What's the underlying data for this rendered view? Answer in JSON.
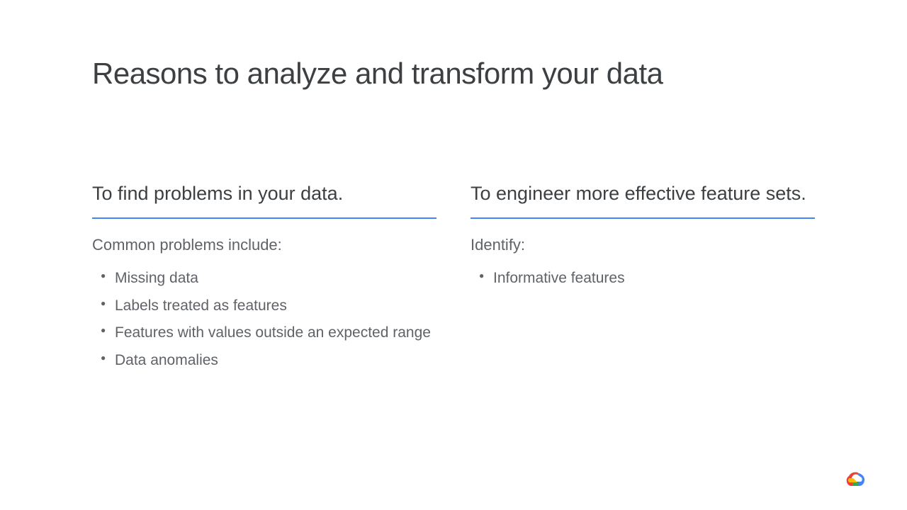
{
  "title": "Reasons to analyze and transform your data",
  "left": {
    "heading": "To find problems in your data.",
    "subheading": "Common problems include:",
    "items": [
      "Missing data",
      "Labels treated as features",
      "Features with values outside an expected range",
      "Data anomalies"
    ]
  },
  "right": {
    "heading": "To engineer more effective feature sets.",
    "subheading": "Identify:",
    "items": [
      "Informative features"
    ]
  }
}
